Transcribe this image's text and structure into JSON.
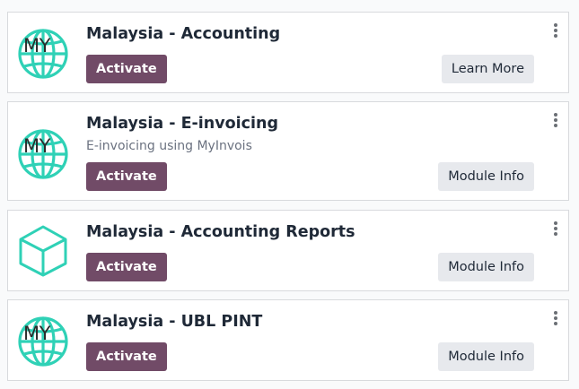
{
  "colors": {
    "activate_bg": "#714b67",
    "secondary_bg": "#e7e9ed",
    "icon_teal": "#2fd1b6"
  },
  "modules": [
    {
      "icon": "globe-icon",
      "badge": "MY",
      "title": "Malaysia - Accounting",
      "description": "",
      "activate_label": "Activate",
      "secondary_label": "Learn More"
    },
    {
      "icon": "globe-icon",
      "badge": "MY",
      "title": "Malaysia - E-invoicing",
      "description": "E-invoicing using MyInvois",
      "activate_label": "Activate",
      "secondary_label": "Module Info"
    },
    {
      "icon": "cube-icon",
      "badge": "",
      "title": "Malaysia - Accounting Reports",
      "description": "",
      "activate_label": "Activate",
      "secondary_label": "Module Info"
    },
    {
      "icon": "globe-icon",
      "badge": "MY",
      "title": "Malaysia - UBL PINT",
      "description": "",
      "activate_label": "Activate",
      "secondary_label": "Module Info"
    }
  ]
}
